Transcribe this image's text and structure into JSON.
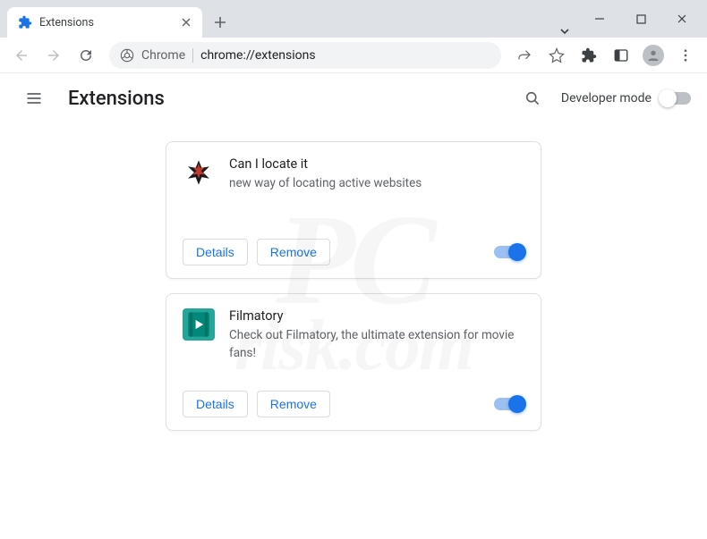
{
  "window": {
    "tab_title": "Extensions"
  },
  "omnibox": {
    "secure_label": "Chrome",
    "url_path": "chrome://extensions"
  },
  "page": {
    "title": "Extensions",
    "developer_mode_label": "Developer mode"
  },
  "buttons": {
    "details": "Details",
    "remove": "Remove"
  },
  "extensions": [
    {
      "name": "Can I locate it",
      "description": "new way of locating active websites",
      "enabled": true,
      "icon": "wings"
    },
    {
      "name": "Filmatory",
      "description": "Check out Filmatory, the ultimate extension for movie fans!",
      "enabled": true,
      "icon": "film"
    }
  ],
  "watermark": {
    "line1": "PC",
    "line2": "risk.com"
  }
}
